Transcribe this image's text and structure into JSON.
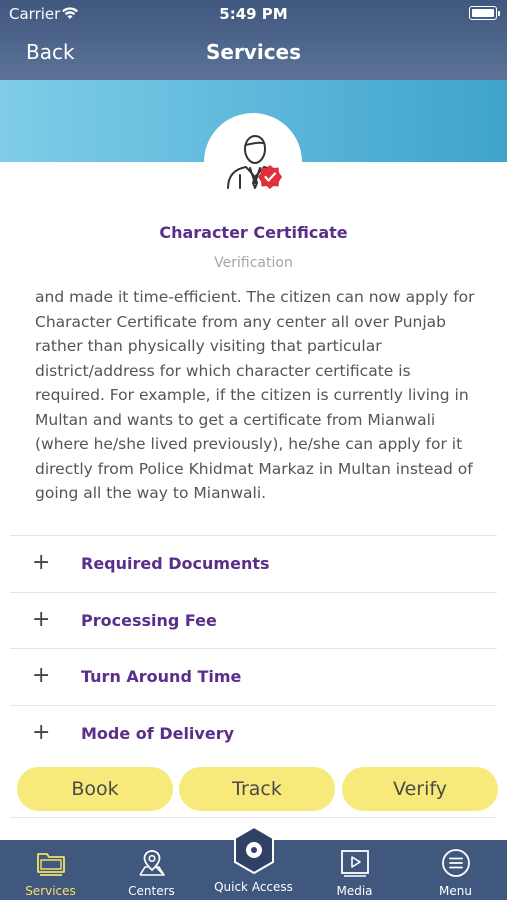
{
  "status_bar": {
    "carrier": "Carrier",
    "time": "5:49 PM"
  },
  "nav": {
    "back_label": "Back",
    "title": "Services"
  },
  "service": {
    "title": "Character Certificate",
    "subtitle": "Verification",
    "description": "and made it time-efficient. The citizen can now apply for Character Certificate from any center all over Punjab rather than physically visiting that particular district/address for which character certificate is required. For example, if the citizen is currently living in Multan and wants to get a certificate from Mianwali (where he/she lived previously), he/she can apply for it directly from Police Khidmat Markaz in Multan instead of going all the way to Mianwali."
  },
  "accordion": [
    {
      "symbol": "+",
      "label": "Required Documents"
    },
    {
      "symbol": "+",
      "label": "Processing Fee"
    },
    {
      "symbol": "+",
      "label": "Turn Around Time"
    },
    {
      "symbol": "+",
      "label": "Mode of Delivery"
    }
  ],
  "actions": {
    "book": "Book",
    "track": "Track",
    "verify": "Verify"
  },
  "tab_bar": {
    "services": "Services",
    "centers": "Centers",
    "quick_access": "Quick Access",
    "media": "Media",
    "menu": "Menu",
    "active": "Services"
  },
  "colors": {
    "header": "#40577e",
    "accent_purple": "#5a2e8a",
    "button_yellow": "#f7ea7a",
    "active_tab": "#f3e06a",
    "badge_red": "#e0303a"
  },
  "icons": [
    "wifi-icon",
    "battery-icon",
    "officer-verified-icon",
    "folder-icon",
    "map-pin-icon",
    "quick-access-icon",
    "play-icon",
    "menu-icon"
  ]
}
